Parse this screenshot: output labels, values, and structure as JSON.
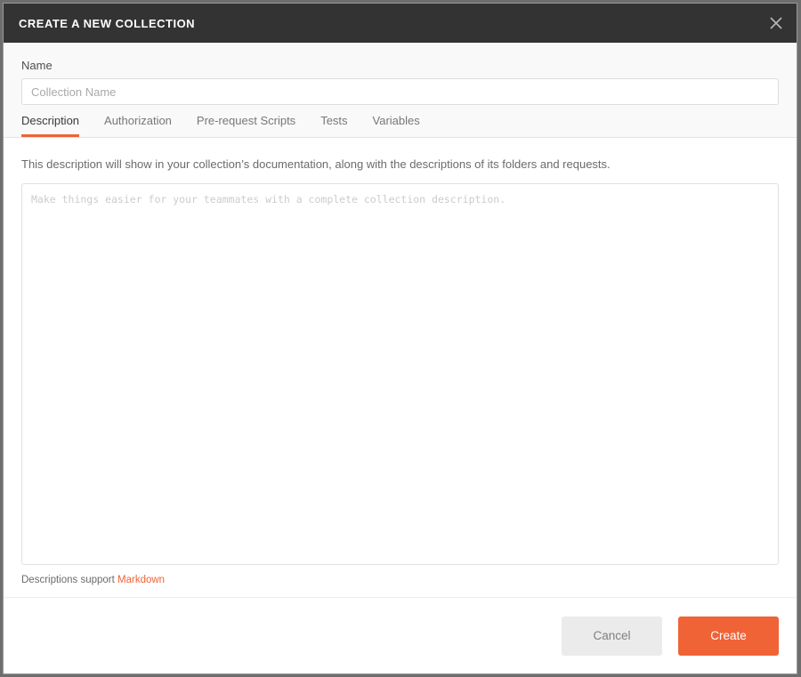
{
  "dialog": {
    "title": "CREATE A NEW COLLECTION",
    "close_icon": "close-icon"
  },
  "name_field": {
    "label": "Name",
    "value": "",
    "placeholder": "Collection Name"
  },
  "tabs": [
    {
      "label": "Description",
      "active": true
    },
    {
      "label": "Authorization",
      "active": false
    },
    {
      "label": "Pre-request Scripts",
      "active": false
    },
    {
      "label": "Tests",
      "active": false
    },
    {
      "label": "Variables",
      "active": false
    }
  ],
  "description_panel": {
    "hint": "This description will show in your collection’s documentation, along with the descriptions of its folders and requests.",
    "textarea_value": "",
    "textarea_placeholder": "Make things easier for your teammates with a complete collection description.",
    "footnote_prefix": "Descriptions support ",
    "footnote_link": "Markdown"
  },
  "footer": {
    "cancel_label": "Cancel",
    "create_label": "Create"
  },
  "colors": {
    "accent": "#ef6337",
    "header_bg": "#333333",
    "top_bg": "#f9f9f9",
    "cancel_bg": "#ebebeb",
    "backdrop": "#6e6e6e"
  }
}
